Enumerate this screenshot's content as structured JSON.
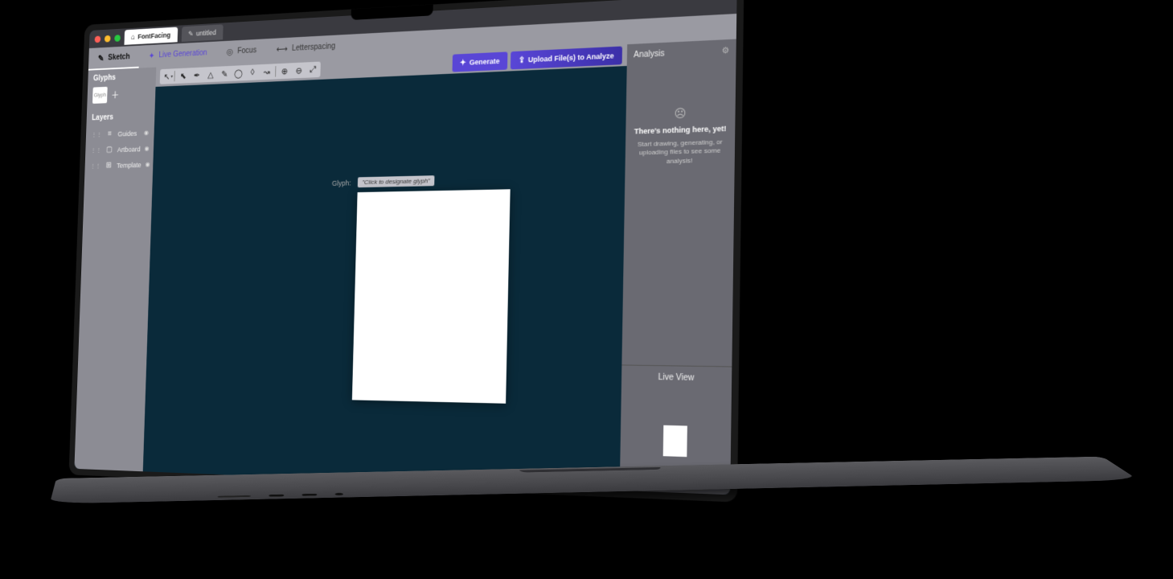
{
  "app": {
    "brand": "FontFacing",
    "untitled_tab": "untitled"
  },
  "modes": {
    "sketch": "Sketch",
    "live_generation": "Live Generation",
    "focus": "Focus",
    "letterspacing": "Letterspacing"
  },
  "sidebar": {
    "glyphs_title": "Glyphs",
    "glyph_thumb_label": "Glyph",
    "layers_title": "Layers",
    "layers": [
      {
        "name": "Guides"
      },
      {
        "name": "Artboard"
      },
      {
        "name": "Template"
      }
    ]
  },
  "toolbar": {
    "generate": "Generate",
    "upload": "Upload File(s) to Analyze"
  },
  "canvas": {
    "glyph_label": "Glyph:",
    "glyph_placeholder": "\"Click to designate glyph\""
  },
  "analysis": {
    "title": "Analysis",
    "empty_title": "There's nothing here, yet!",
    "empty_body": "Start drawing, generating, or uploading files to see some analysis!"
  },
  "liveview": {
    "title": "Live View"
  },
  "tool_names": {
    "select": "select",
    "direct": "direct-select",
    "pen": "pen",
    "shape": "shape",
    "pencil": "pencil",
    "ellipse": "ellipse",
    "polygon": "polygon",
    "path": "path",
    "zoomin": "zoom-in",
    "zoomout": "zoom-out",
    "fit": "fit-screen"
  }
}
